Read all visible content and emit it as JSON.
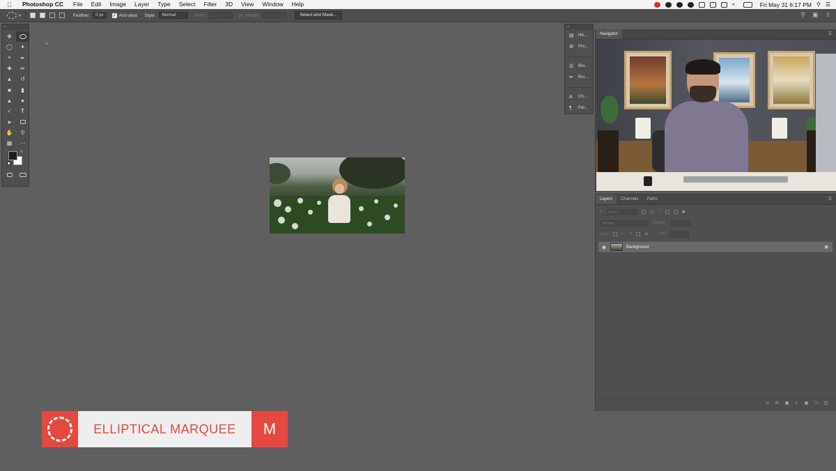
{
  "menubar": {
    "app_name": "Photoshop CC",
    "items": [
      "File",
      "Edit",
      "Image",
      "Layer",
      "Type",
      "Select",
      "Filter",
      "3D",
      "View",
      "Window",
      "Help"
    ],
    "clock": "Fri May 31  6:17 PM"
  },
  "options_bar": {
    "feather_label": "Feather:",
    "feather_value": "0 px",
    "anti_alias_label": "Anti-alias",
    "style_label": "Style:",
    "style_value": "Normal",
    "width_label": "Width:",
    "height_label": "Height:",
    "select_mask_label": "Select and Mask..."
  },
  "side_panels": {
    "items": [
      {
        "label": "His...",
        "icon": "history-icon"
      },
      {
        "label": "Pro...",
        "icon": "properties-icon"
      },
      {
        "label": "Bru...",
        "icon": "brush-settings-icon"
      },
      {
        "label": "Bru...",
        "icon": "brushes-icon"
      },
      {
        "label": "Ch...",
        "icon": "character-icon"
      },
      {
        "label": "Par...",
        "icon": "paragraph-icon"
      }
    ]
  },
  "navigator": {
    "tab": "Navigator"
  },
  "layers_panel": {
    "tabs": [
      "Layers",
      "Channels",
      "Paths"
    ],
    "filter_placeholder": "Kind",
    "blend_mode": "Normal",
    "opacity_label": "Opacity:",
    "lock_label": "Lock:",
    "fill_label": "Fill:",
    "layer_name": "Background"
  },
  "banner": {
    "tool_name": "ELLIPTICAL MARQUEE",
    "shortcut": "M",
    "accent_color": "#e5483f"
  }
}
